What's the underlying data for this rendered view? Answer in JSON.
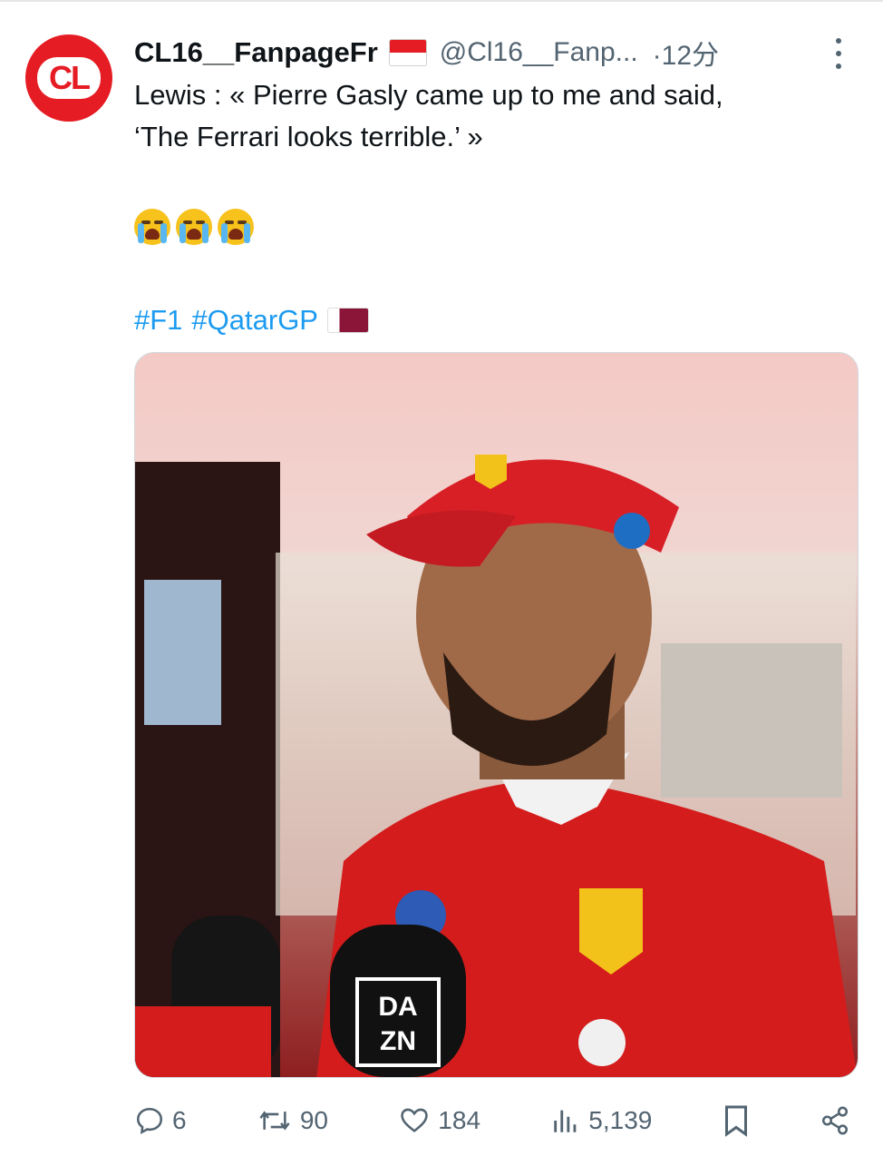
{
  "tweet": {
    "display_name": "CL16__FanpageFr",
    "handle": "@Cl16__Fanp...",
    "time": "·12分",
    "avatar_text": "CL",
    "text": "Lewis : « Pierre Gasly came up to me and said,\n‘The Ferrari looks terrible.’ »",
    "emojis": [
      "crying-face",
      "crying-face",
      "crying-face"
    ],
    "hashtags": [
      "#F1",
      "#QatarGP"
    ],
    "flags": {
      "author": "monaco",
      "hashtag": "qatar"
    }
  },
  "media": {
    "mic_labels": [
      "DA",
      "ZN"
    ]
  },
  "actions": {
    "replies": "6",
    "retweets": "90",
    "likes": "184",
    "views": "5,139"
  },
  "colors": {
    "link": "#1d9bf0",
    "secondary_text": "#536471",
    "brand_red": "#e51c23"
  }
}
